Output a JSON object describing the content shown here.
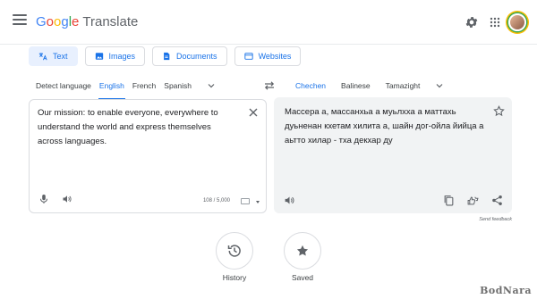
{
  "header": {
    "logo_word": "Google",
    "product_name": "Translate",
    "icons": [
      "menu-icon",
      "gear-icon",
      "apps-grid-icon",
      "avatar"
    ],
    "brand_colors": [
      "#4285f4",
      "#ea4335",
      "#fbbc05",
      "#34a853"
    ]
  },
  "modes": [
    {
      "label": "Text",
      "icon": "translate-icon",
      "active": true
    },
    {
      "label": "Images",
      "icon": "image-icon",
      "active": false
    },
    {
      "label": "Documents",
      "icon": "document-icon",
      "active": false
    },
    {
      "label": "Websites",
      "icon": "website-icon",
      "active": false
    }
  ],
  "source_langs": [
    "Detect language",
    "English",
    "French",
    "Spanish"
  ],
  "source_active": "English",
  "target_langs": [
    "Chechen",
    "Balinese",
    "Tamazight"
  ],
  "target_active": "Chechen",
  "source": {
    "text": "Our mission: to enable everyone, everywhere to understand the world and express themselves across languages.",
    "char_count": "108 / 5,000"
  },
  "target": {
    "text": "Массера а, массанхьа а муьлхха а маттахь дуьненан кхетам хилита а, шайн дог-ойла йийца а аьтто хилар - тха декхар ду"
  },
  "feedback_label": "Send feedback",
  "bottom": {
    "history_label": "History",
    "saved_label": "Saved"
  },
  "watermark": "BodNara",
  "accent_color": "#1a73e8"
}
